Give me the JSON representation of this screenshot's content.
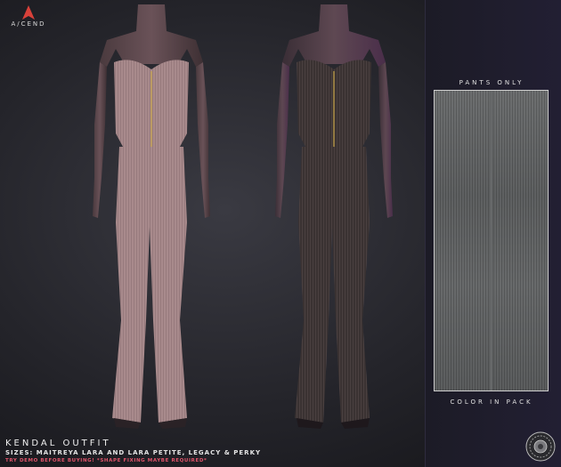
{
  "brand": {
    "logo_text": "A/CEND"
  },
  "swatch": {
    "top_caption": "PANTS ONLY",
    "bottom_caption": "COLOR IN PACK"
  },
  "product": {
    "title": "KENDAL OUTFIT",
    "sizes": "SIZES: MAITREYA LARA AND LARA PETITE, LEGACY & PERKY",
    "warning": "TRY DEMO BEFORE BUYING! *SHAPE FIXING MAYBE REQUIRED*"
  },
  "colors": {
    "pink_outfit": "#a88a8c",
    "dark_outfit": "#3a3232",
    "brand_red": "#d8413a",
    "warning_red": "#e0536a",
    "panel_bg": "#221f33"
  },
  "icons": [
    "ascend-logo-icon",
    "seal-badge-icon"
  ]
}
